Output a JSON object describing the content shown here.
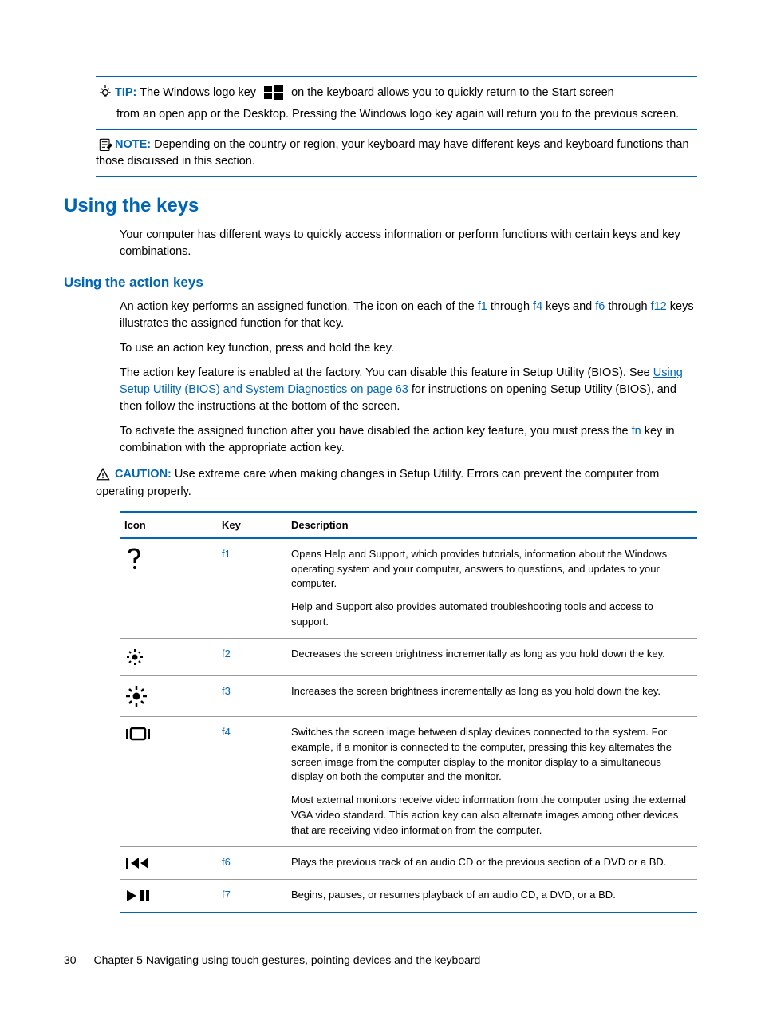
{
  "callouts": {
    "tip": {
      "label": "TIP:",
      "text_before": "The Windows logo key",
      "text_after": "on the keyboard allows you to quickly return to the Start screen",
      "continue": "from an open app or the Desktop. Pressing the Windows logo key again will return you to the previous screen."
    },
    "note": {
      "label": "NOTE:",
      "text": "Depending on the country or region, your keyboard may have different keys and keyboard functions than those discussed in this section."
    },
    "caution": {
      "label": "CAUTION:",
      "text": "Use extreme care when making changes in Setup Utility. Errors can prevent the computer from operating properly."
    }
  },
  "headings": {
    "using_keys": "Using the keys",
    "using_action_keys": "Using the action keys"
  },
  "paragraphs": {
    "keys_intro": "Your computer has different ways to quickly access information or perform functions with certain keys and key combinations.",
    "action1a": "An action key performs an assigned function. The icon on each of the ",
    "action1_f1": "f1",
    "action1b": " through ",
    "action1_f4": "f4",
    "action1c": " keys and ",
    "action1_f6": "f6",
    "action1d": " through ",
    "action1_f12": "f12",
    "action1e": " keys illustrates the assigned function for that key.",
    "action2": "To use an action key function, press and hold the key.",
    "action3a": "The action key feature is enabled at the factory. You can disable this feature in Setup Utility (BIOS). See ",
    "action3_link": "Using Setup Utility (BIOS) and System Diagnostics on page 63",
    "action3b": " for instructions on opening Setup Utility (BIOS), and then follow the instructions at the bottom of the screen.",
    "action4a": "To activate the assigned function after you have disabled the action key feature, you must press the ",
    "action4_fn": "fn",
    "action4b": " key in combination with the appropriate action key."
  },
  "table": {
    "headers": {
      "icon": "Icon",
      "key": "Key",
      "desc": "Description"
    },
    "rows": [
      {
        "icon": "help-icon",
        "key": "f1",
        "desc1": "Opens Help and Support, which provides tutorials, information about the Windows operating system and your computer, answers to questions, and updates to your computer.",
        "desc2": "Help and Support also provides automated troubleshooting tools and access to support."
      },
      {
        "icon": "brightness-down-icon",
        "key": "f2",
        "desc1": "Decreases the screen brightness incrementally as long as you hold down the key."
      },
      {
        "icon": "brightness-up-icon",
        "key": "f3",
        "desc1": "Increases the screen brightness incrementally as long as you hold down the key."
      },
      {
        "icon": "switch-display-icon",
        "key": "f4",
        "desc1": "Switches the screen image between display devices connected to the system. For example, if a monitor is connected to the computer, pressing this key alternates the screen image from the computer display to the monitor display to a simultaneous display on both the computer and the monitor.",
        "desc2": "Most external monitors receive video information from the computer using the external VGA video standard. This action key can also alternate images among other devices that are receiving video information from the computer."
      },
      {
        "icon": "prev-track-icon",
        "key": "f6",
        "desc1": "Plays the previous track of an audio CD or the previous section of a DVD or a BD."
      },
      {
        "icon": "play-pause-icon",
        "key": "f7",
        "desc1": "Begins, pauses, or resumes playback of an audio CD, a DVD, or a BD."
      }
    ]
  },
  "footer": {
    "page": "30",
    "chapter": "Chapter 5   Navigating using touch gestures, pointing devices and the keyboard"
  }
}
